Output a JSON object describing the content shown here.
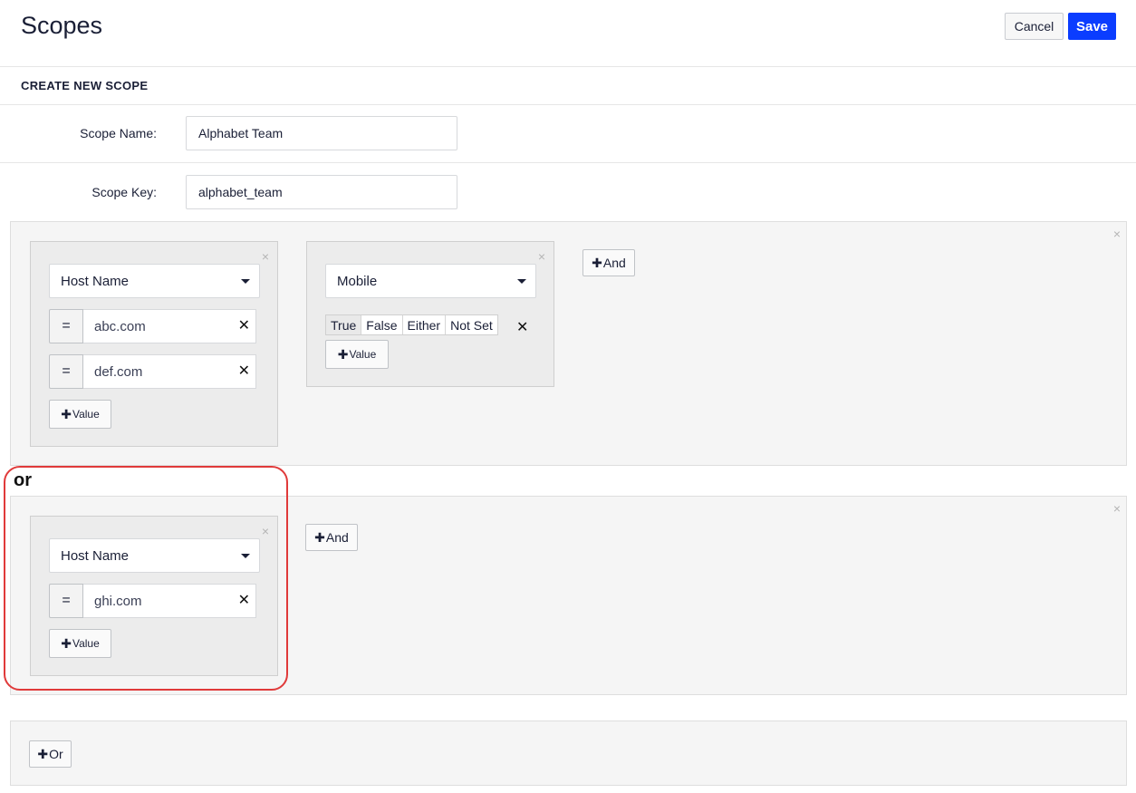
{
  "header": {
    "title": "Scopes",
    "cancel_label": "Cancel",
    "save_label": "Save"
  },
  "form": {
    "section_title": "CREATE NEW SCOPE",
    "scope_name_label": "Scope Name:",
    "scope_name_value": "Alphabet Team",
    "scope_key_label": "Scope Key:",
    "scope_key_value": "alphabet_team"
  },
  "groups": [
    {
      "conditions": [
        {
          "field": "Host Name",
          "values": [
            {
              "op": "=",
              "value": "abc.com"
            },
            {
              "op": "=",
              "value": "def.com"
            }
          ],
          "add_value_label": "Value"
        },
        {
          "field": "Mobile",
          "options": [
            "True",
            "False",
            "Either",
            "Not Set"
          ],
          "selected": "True",
          "add_value_label": "Value"
        }
      ],
      "and_label": "And"
    },
    {
      "conditions": [
        {
          "field": "Host Name",
          "values": [
            {
              "op": "=",
              "value": "ghi.com"
            }
          ],
          "add_value_label": "Value"
        }
      ],
      "and_label": "And"
    }
  ],
  "or_label": "or",
  "add_or_label": "Or",
  "icons": {
    "close": "×",
    "remove": "✕",
    "plus": "✚"
  },
  "colors": {
    "primary": "#0b3dff",
    "highlight": "#e03a3a"
  }
}
